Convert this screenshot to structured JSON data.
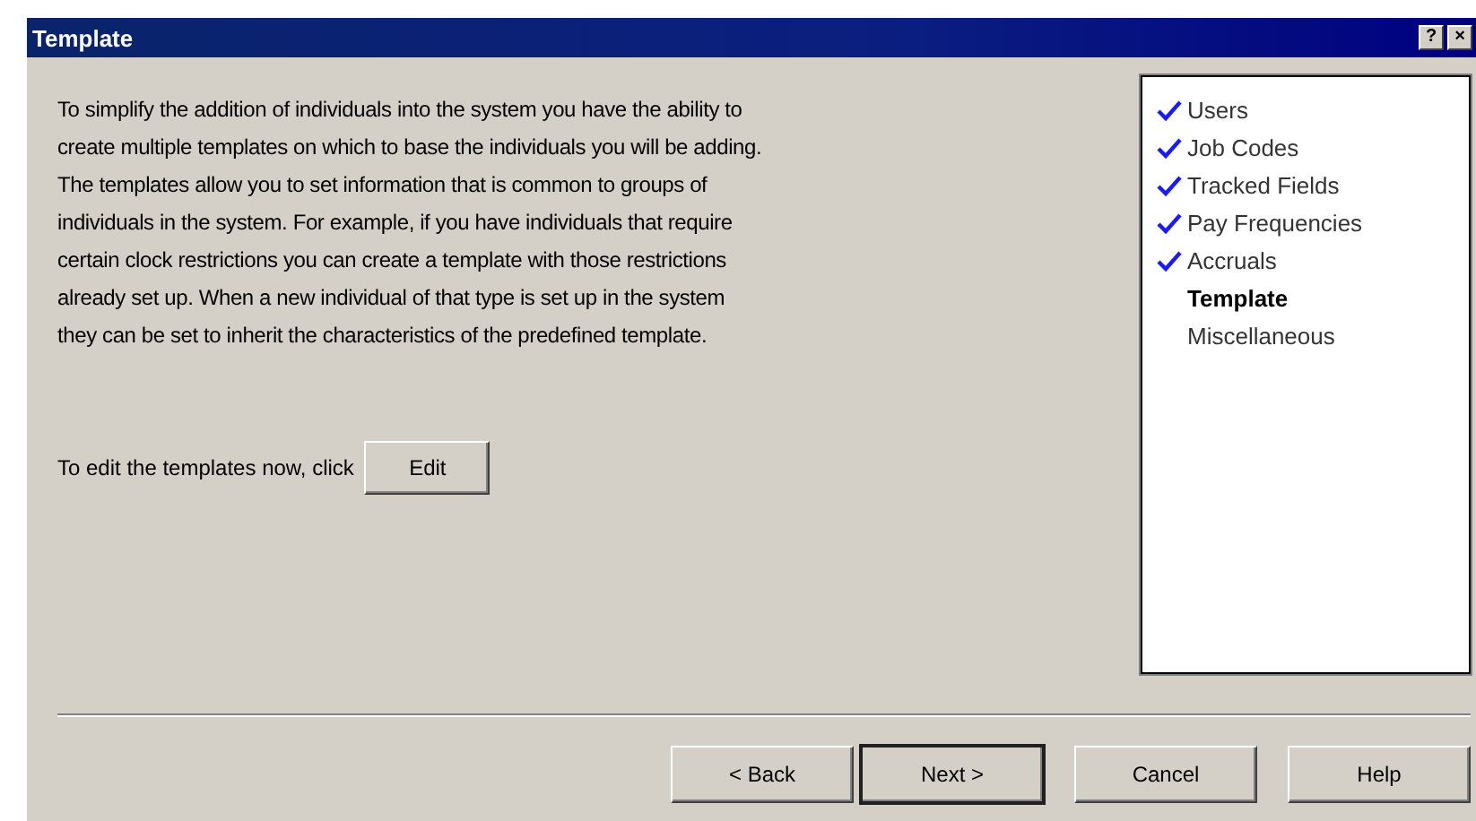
{
  "window": {
    "title": "Template",
    "title_buttons": [
      "?",
      "×"
    ]
  },
  "description_lines": [
    "To simplify the addition of individuals into the system you have the ability to",
    "create multiple templates on which to base the individuals you will be adding.",
    "The templates allow you to set information that is common to groups of",
    "individuals in the system.  For example, if you have individuals that require",
    "certain clock restrictions you can create a template with those restrictions",
    "already set up.  When a new individual of that type is set up in the system",
    "they can be set to inherit the characteristics of the predefined template."
  ],
  "edit_prompt": {
    "label": "To edit the templates now, click",
    "button": "Edit"
  },
  "steps": [
    {
      "label": "Users",
      "checked": true,
      "selected": false
    },
    {
      "label": "Job Codes",
      "checked": true,
      "selected": false
    },
    {
      "label": "Tracked Fields",
      "checked": true,
      "selected": false
    },
    {
      "label": "Pay Frequencies",
      "checked": true,
      "selected": false
    },
    {
      "label": "Accruals",
      "checked": true,
      "selected": false
    },
    {
      "label": "Template",
      "checked": false,
      "selected": true
    },
    {
      "label": "Miscellaneous",
      "checked": false,
      "selected": false
    }
  ],
  "buttons": [
    {
      "label": "< Back",
      "default": false
    },
    {
      "label": "Next >",
      "default": true
    },
    {
      "label": "Cancel",
      "default": false
    },
    {
      "label": "Help",
      "default": false
    }
  ]
}
